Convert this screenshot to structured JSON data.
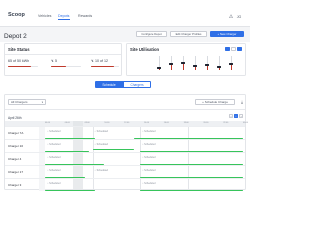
{
  "nav": {
    "logo": "Scoop",
    "links": [
      {
        "label": "Vehicles",
        "active": false
      },
      {
        "label": "Depots",
        "active": true
      },
      {
        "label": "Rewards",
        "active": false
      }
    ],
    "icons": [
      "alert-icon",
      "avatar-icon"
    ],
    "avatar_initials": "JG"
  },
  "header": {
    "title": "Depot 2",
    "buttons": [
      {
        "label": "Configure Depot",
        "primary": false
      },
      {
        "label": "Edit Charger Profiles",
        "primary": false
      },
      {
        "label": "+ New Charger",
        "primary": true
      }
    ]
  },
  "site_status": {
    "title": "Site Status",
    "stats": [
      {
        "text": "65 of 50 kWh",
        "color": "#c0392b",
        "fill": 0.78
      },
      {
        "text": "↯ 5",
        "color": "#c0392b",
        "fill": 0.5
      },
      {
        "text": "↯ 10 of 12",
        "color": "#c0392b",
        "fill": 0.83
      }
    ]
  },
  "site_utilisation": {
    "title": "Site Utilisation",
    "toggles": [
      true,
      false,
      true
    ],
    "sliders": [
      0.2,
      0.6,
      0.75,
      0.45,
      0.5,
      0.35,
      0.6
    ]
  },
  "tabs": {
    "schedule": "Schedule",
    "chargers": "Chargers"
  },
  "schedule": {
    "filter_label": "All Chargers",
    "schedule_button": "+ Schedule Charge",
    "date": "April 26th",
    "ticks": [
      "04:00",
      "06:00",
      "08:00",
      "10:00",
      "12:00",
      "14:00",
      "16:00",
      "18:00",
      "20:00",
      "22:00",
      "00:00"
    ],
    "rows": [
      {
        "label": "Charger 7A",
        "events": [
          {
            "text": "Scheduled",
            "pos": 0.0
          },
          {
            "text": "Scheduled",
            "pos": 0.24
          },
          {
            "text": "Scheduled",
            "pos": 0.48
          }
        ],
        "bars": [
          [
            0.0,
            0.25
          ],
          [
            0.45,
            1.0
          ]
        ]
      },
      {
        "label": "Charger 10",
        "events": [
          {
            "text": "Scheduled",
            "pos": 0.0
          },
          {
            "text": "Scheduled",
            "pos": 0.24
          },
          {
            "text": "Scheduled",
            "pos": 0.48
          }
        ],
        "bars": [
          [
            0.0,
            0.22
          ],
          [
            0.24,
            0.45
          ],
          [
            0.48,
            1.0
          ]
        ]
      },
      {
        "label": "Charger 4",
        "events": [
          {
            "text": "Scheduled",
            "pos": 0.0
          },
          {
            "text": "Scheduled",
            "pos": 0.48
          }
        ],
        "bars": [
          [
            0.0,
            0.3
          ],
          [
            0.48,
            1.0
          ]
        ]
      },
      {
        "label": "Charger 17",
        "events": [
          {
            "text": "Scheduled",
            "pos": 0.0
          },
          {
            "text": "Scheduled",
            "pos": 0.24
          },
          {
            "text": "Scheduled",
            "pos": 0.48
          }
        ],
        "bars": [
          [
            0.0,
            0.2
          ],
          [
            0.48,
            1.0
          ]
        ]
      },
      {
        "label": "Charger 3",
        "events": [
          {
            "text": "Scheduled",
            "pos": 0.0
          },
          {
            "text": "Scheduled",
            "pos": 0.48
          }
        ],
        "bars": [
          [
            0.0,
            0.25
          ],
          [
            0.48,
            1.0
          ]
        ]
      }
    ]
  },
  "colors": {
    "accent": "#2f6fe6",
    "green": "#37c45b",
    "red": "#c0392b"
  }
}
